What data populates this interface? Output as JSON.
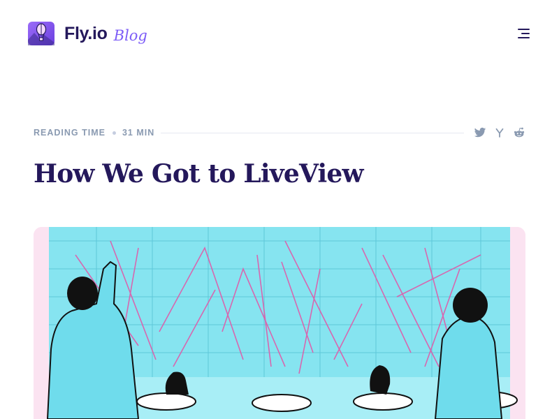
{
  "header": {
    "brand": "Fly.io",
    "sub_brand": "Blog",
    "logo_icon": "fly-balloon-logo-icon",
    "menu_icon": "hamburger-menu-icon"
  },
  "meta": {
    "reading_time_label": "Reading time",
    "reading_time_value": "31 min",
    "share": [
      {
        "name": "twitter-icon"
      },
      {
        "name": "hacker-news-icon"
      },
      {
        "name": "reddit-icon"
      }
    ]
  },
  "article": {
    "title": "How We Got to LiveView",
    "hero_image": "illustration of two people operating a large computer panel with ravens"
  },
  "colors": {
    "brand_text": "#24185b",
    "accent_purple": "#7c5cf7",
    "meta_gray": "#8a9ab1",
    "hero_cyan": "#7fe3f0",
    "hero_pink": "#e05aa8"
  }
}
